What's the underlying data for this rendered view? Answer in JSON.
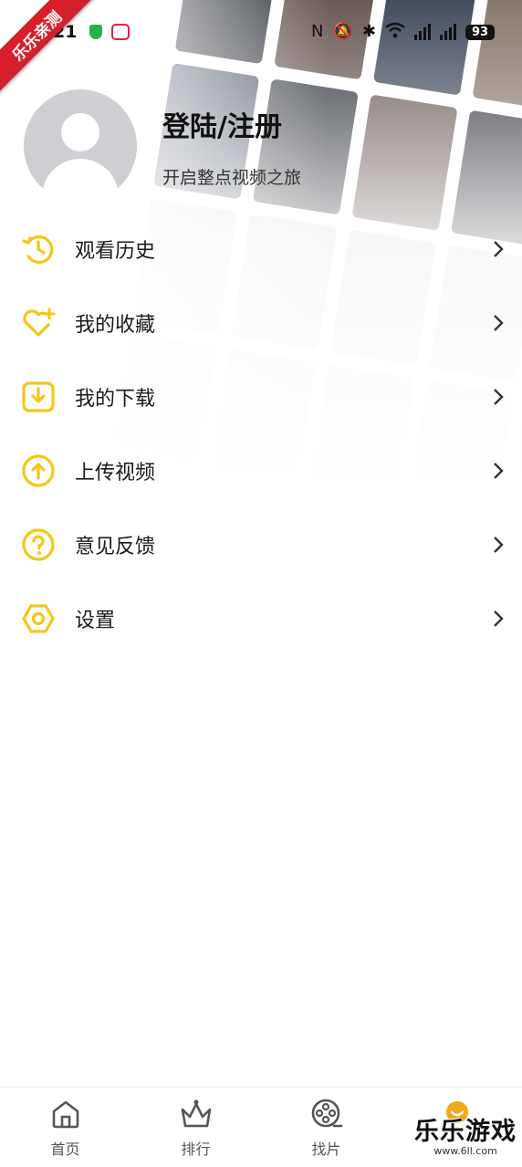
{
  "status_bar": {
    "time": "21",
    "battery": "93"
  },
  "corner_badge": "乐乐亲测",
  "profile": {
    "title": "登陆/注册",
    "subtitle": "开启整点视频之旅"
  },
  "menu": [
    {
      "label": "观看历史",
      "icon": "history-icon"
    },
    {
      "label": "我的收藏",
      "icon": "heart-plus-icon"
    },
    {
      "label": "我的下载",
      "icon": "download-icon"
    },
    {
      "label": "上传视频",
      "icon": "upload-icon"
    },
    {
      "label": "意见反馈",
      "icon": "question-icon"
    },
    {
      "label": "设置",
      "icon": "settings-hex-icon"
    }
  ],
  "bottom_nav": [
    {
      "label": "首页",
      "icon": "home-icon"
    },
    {
      "label": "排行",
      "icon": "crown-icon"
    },
    {
      "label": "找片",
      "icon": "film-reel-icon"
    },
    {
      "label": "",
      "icon": "profile-active-icon"
    }
  ],
  "watermark": {
    "text": "乐乐游戏",
    "url": "www.6ll.com"
  },
  "colors": {
    "accent": "#f5c518",
    "active": "#f2a81c",
    "badge": "#d61f2b"
  }
}
